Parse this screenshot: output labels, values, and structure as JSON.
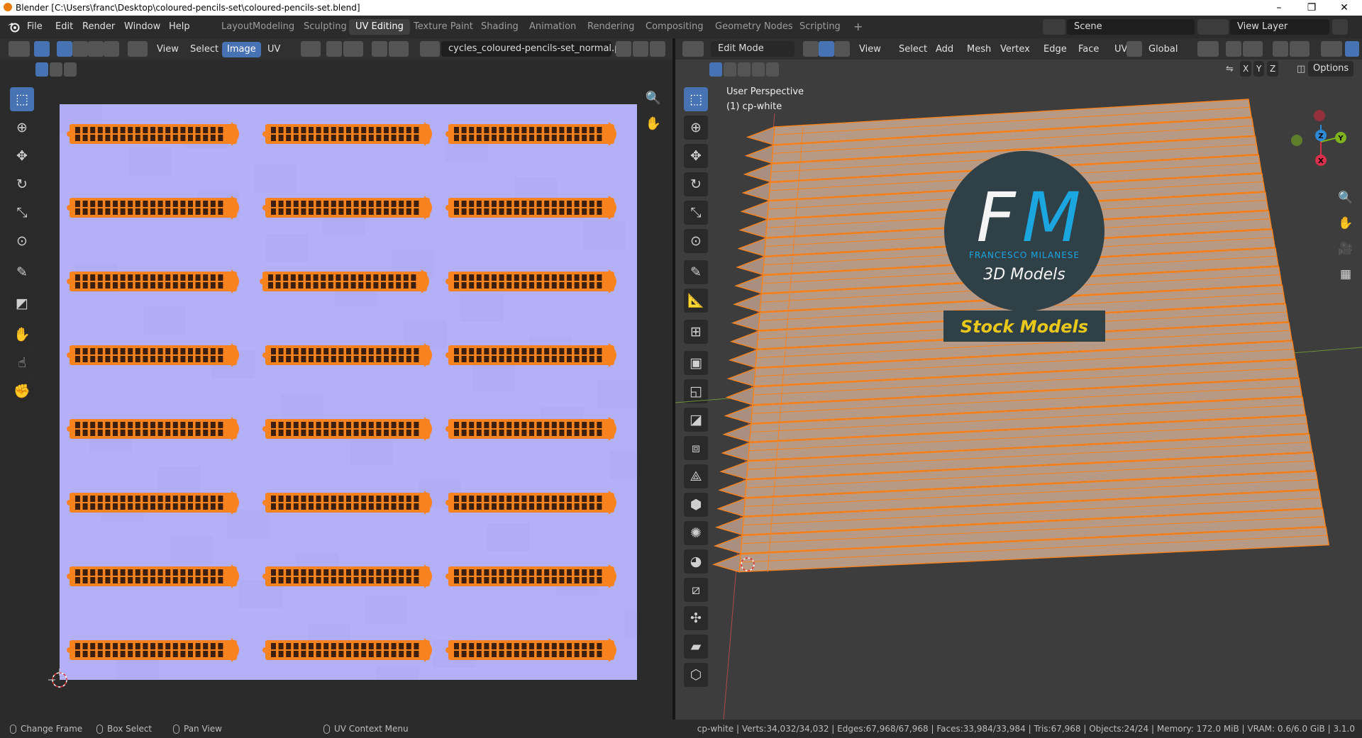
{
  "window": {
    "title": "Blender [C:\\Users\\franc\\Desktop\\coloured-pencils-set\\coloured-pencils-set.blend]",
    "minimize": "–",
    "maximize": "❐",
    "close": "✕"
  },
  "menus": [
    "File",
    "Edit",
    "Render",
    "Window",
    "Help"
  ],
  "workspaces": [
    "Layout",
    "Modeling",
    "Sculpting",
    "UV Editing",
    "Texture Paint",
    "Shading",
    "Animation",
    "Rendering",
    "Compositing",
    "Geometry Nodes",
    "Scripting"
  ],
  "active_workspace": "UV Editing",
  "add_workspace": "+",
  "scene": {
    "name": "Scene"
  },
  "view_layer": {
    "name": "View Layer"
  },
  "uv_editor": {
    "menus": [
      "View",
      "Select",
      "Image",
      "UV"
    ],
    "active_menu": "Image",
    "image_name": "cycles_coloured-pencils-set_normal.png",
    "rows": 8,
    "cols": 3,
    "colors": {
      "background": "#b4b0f8",
      "island": "#f7821e",
      "stripe": "#3c1f0a"
    }
  },
  "viewport": {
    "mode": "Edit Mode",
    "menus": [
      "View",
      "Select",
      "Add",
      "Mesh",
      "Vertex",
      "Edge",
      "Face",
      "UV"
    ],
    "transform_orientation": "Global",
    "options_label": "Options",
    "axis_labels": [
      "X",
      "Y",
      "Z"
    ],
    "perspective_label": "User Perspective",
    "object_label": "(1) cp-white",
    "pencil_count": 24,
    "gizmo": {
      "x": "X",
      "y": "Y",
      "z": "Z"
    },
    "logo": {
      "initials_f": "F",
      "initials_m": "M",
      "name": "FRANCESCO MILANESE",
      "subtitle": "3D Models",
      "banner": "Stock Models",
      "colors": {
        "circle": "#2f4047",
        "accent": "#1ba6e0",
        "banner_text": "#e9c81a"
      }
    }
  },
  "status": {
    "change_frame": "Change Frame",
    "box_select": "Box Select",
    "pan_view": "Pan View",
    "uv_context_menu": "UV Context Menu",
    "stats": "cp-white | Verts:34,032/34,032 | Edges:67,968/67,968 | Faces:33,984/33,984 | Tris:67,968 | Objects:24/24 | Memory: 172.0 MiB | VRAM: 0.6/6.0 GiB | 3.1.0"
  }
}
